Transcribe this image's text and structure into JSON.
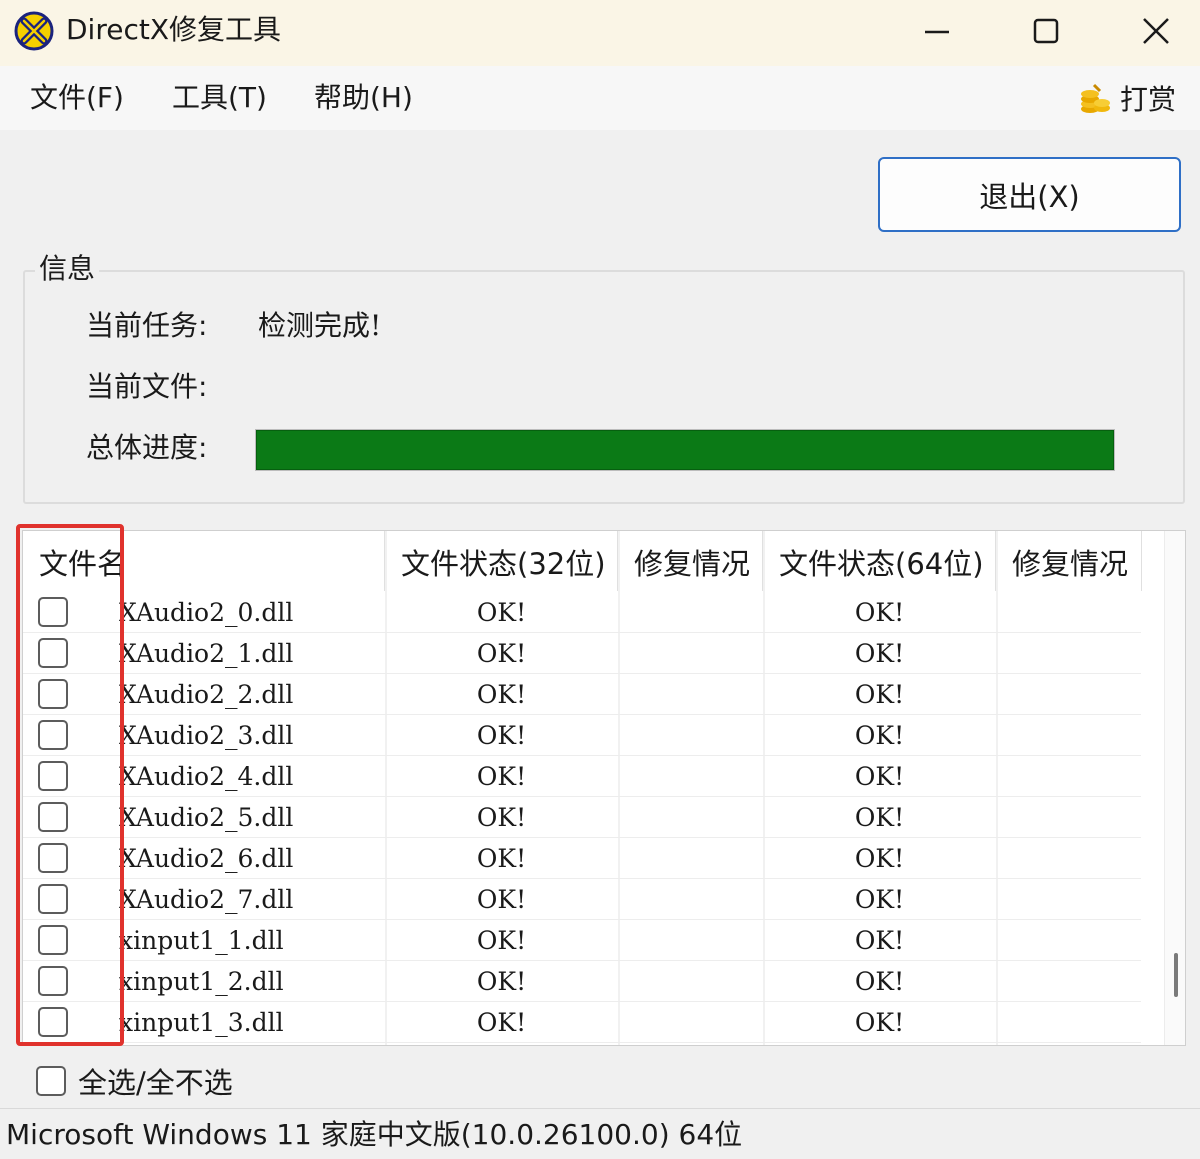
{
  "window": {
    "title": "DirectX修复工具",
    "icon": "directx-logo-icon",
    "controls": [
      "minimize-icon",
      "maximize-icon",
      "close-icon"
    ]
  },
  "menu": {
    "file": "文件(F)",
    "tools": "工具(T)",
    "help": "帮助(H)",
    "donate": "打赏",
    "donate_icon": "coins-icon"
  },
  "exit_button": "退出(X)",
  "info": {
    "group_title": "信息",
    "current_task_label": "当前任务:",
    "current_task_value": "检测完成!",
    "current_file_label": "当前文件:",
    "current_file_value": "",
    "overall_progress_label": "总体进度:",
    "overall_progress": 1.0,
    "progress_color": "#0b7a16"
  },
  "table": {
    "columns": [
      "文件名",
      "文件状态(32位)",
      "修复情况",
      "文件状态(64位)",
      "修复情况"
    ],
    "rows": [
      {
        "name": "XAudio2_0.dll",
        "status32": "OK!",
        "repair32": "",
        "status64": "OK!",
        "repair64": "",
        "checked": false
      },
      {
        "name": "XAudio2_1.dll",
        "status32": "OK!",
        "repair32": "",
        "status64": "OK!",
        "repair64": "",
        "checked": false
      },
      {
        "name": "XAudio2_2.dll",
        "status32": "OK!",
        "repair32": "",
        "status64": "OK!",
        "repair64": "",
        "checked": false
      },
      {
        "name": "XAudio2_3.dll",
        "status32": "OK!",
        "repair32": "",
        "status64": "OK!",
        "repair64": "",
        "checked": false
      },
      {
        "name": "XAudio2_4.dll",
        "status32": "OK!",
        "repair32": "",
        "status64": "OK!",
        "repair64": "",
        "checked": false
      },
      {
        "name": "XAudio2_5.dll",
        "status32": "OK!",
        "repair32": "",
        "status64": "OK!",
        "repair64": "",
        "checked": false
      },
      {
        "name": "XAudio2_6.dll",
        "status32": "OK!",
        "repair32": "",
        "status64": "OK!",
        "repair64": "",
        "checked": false
      },
      {
        "name": "XAudio2_7.dll",
        "status32": "OK!",
        "repair32": "",
        "status64": "OK!",
        "repair64": "",
        "checked": false
      },
      {
        "name": "xinput1_1.dll",
        "status32": "OK!",
        "repair32": "",
        "status64": "OK!",
        "repair64": "",
        "checked": false
      },
      {
        "name": "xinput1_2.dll",
        "status32": "OK!",
        "repair32": "",
        "status64": "OK!",
        "repair64": "",
        "checked": false
      },
      {
        "name": "xinput1_3.dll",
        "status32": "OK!",
        "repair32": "",
        "status64": "OK!",
        "repair64": "",
        "checked": false
      }
    ]
  },
  "select_all_label": "全选/全不选",
  "status_bar": "Microsoft Windows 11 家庭中文版(10.0.26100.0) 64位",
  "colors": {
    "highlight_box": "#e0322d",
    "exit_button_border": "#2f6fc6"
  }
}
